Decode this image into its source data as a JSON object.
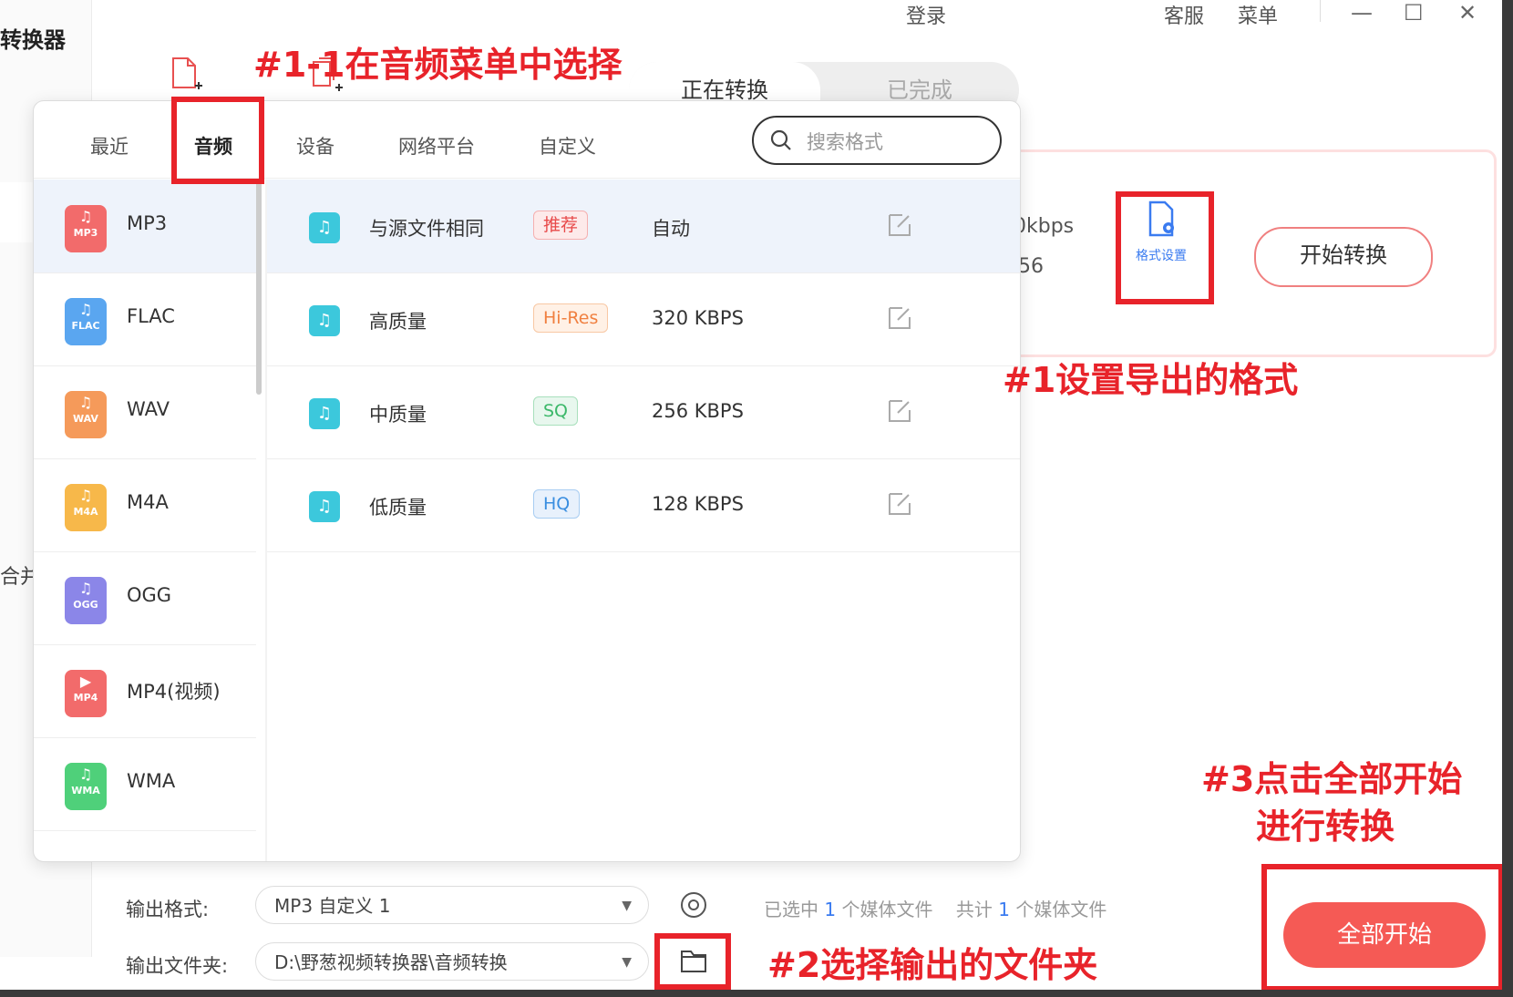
{
  "app": {
    "title_fragment": "转换器",
    "sidebar_fragment": "合并"
  },
  "titlebar": {
    "login": "登录",
    "service": "客服",
    "menu": "菜单",
    "minimize": "—",
    "maximize": "☐",
    "close": "✕"
  },
  "tabs": {
    "converting": "正在转换",
    "completed": "已完成"
  },
  "task": {
    "bitrate_fragment": "0kbps",
    "size_fragment": "56",
    "format_settings_label": "格式设置",
    "start_label": "开始转换"
  },
  "panel": {
    "categories": [
      "最近",
      "音频",
      "设备",
      "网络平台",
      "自定义"
    ],
    "active_category": "音频",
    "search_placeholder": "搜索格式",
    "formats": [
      {
        "name": "MP3",
        "tag": "MP3",
        "color": "#f26b6b"
      },
      {
        "name": "FLAC",
        "tag": "FLAC",
        "color": "#5aa6f0"
      },
      {
        "name": "WAV",
        "tag": "WAV",
        "color": "#f59a5a"
      },
      {
        "name": "M4A",
        "tag": "M4A",
        "color": "#f7b84a"
      },
      {
        "name": "OGG",
        "tag": "OGG",
        "color": "#8b86e8"
      },
      {
        "name": "MP4(视频)",
        "tag": "MP4",
        "color": "#f26b6b"
      },
      {
        "name": "WMA",
        "tag": "WMA",
        "color": "#4fd07a"
      }
    ],
    "qualities": [
      {
        "name": "与源文件相同",
        "badge": "推荐",
        "badge_color": "#e84a4a",
        "badge_bg": "#fdeaea",
        "rate": "自动"
      },
      {
        "name": "高质量",
        "badge": "Hi-Res",
        "badge_color": "#f08040",
        "badge_bg": "#fff1e6",
        "rate": "320 KBPS"
      },
      {
        "name": "中质量",
        "badge": "SQ",
        "badge_color": "#3cb86a",
        "badge_bg": "#e8f7ee",
        "rate": "256 KBPS"
      },
      {
        "name": "低质量",
        "badge": "HQ",
        "badge_color": "#3a8ee0",
        "badge_bg": "#e8f1fc",
        "rate": "128 KBPS"
      }
    ]
  },
  "bottom": {
    "output_format_label": "输出格式:",
    "output_format_value": "MP3 自定义 1",
    "output_folder_label": "输出文件夹:",
    "output_folder_value": "D:\\野葱视频转换器\\音频转换",
    "selected_prefix": "已选中",
    "selected_count": "1",
    "selected_suffix": "个媒体文件",
    "total_prefix": "共计",
    "total_count": "1",
    "total_suffix": "个媒体文件",
    "start_all": "全部开始"
  },
  "annotations": {
    "step_1_1": "#1-1在音频菜单中选择",
    "step_1": "#1设置导出的格式",
    "step_2": "#2选择输出的文件夹",
    "step_3_line1": "#3点击全部开始",
    "step_3_line2": "进行转换"
  }
}
